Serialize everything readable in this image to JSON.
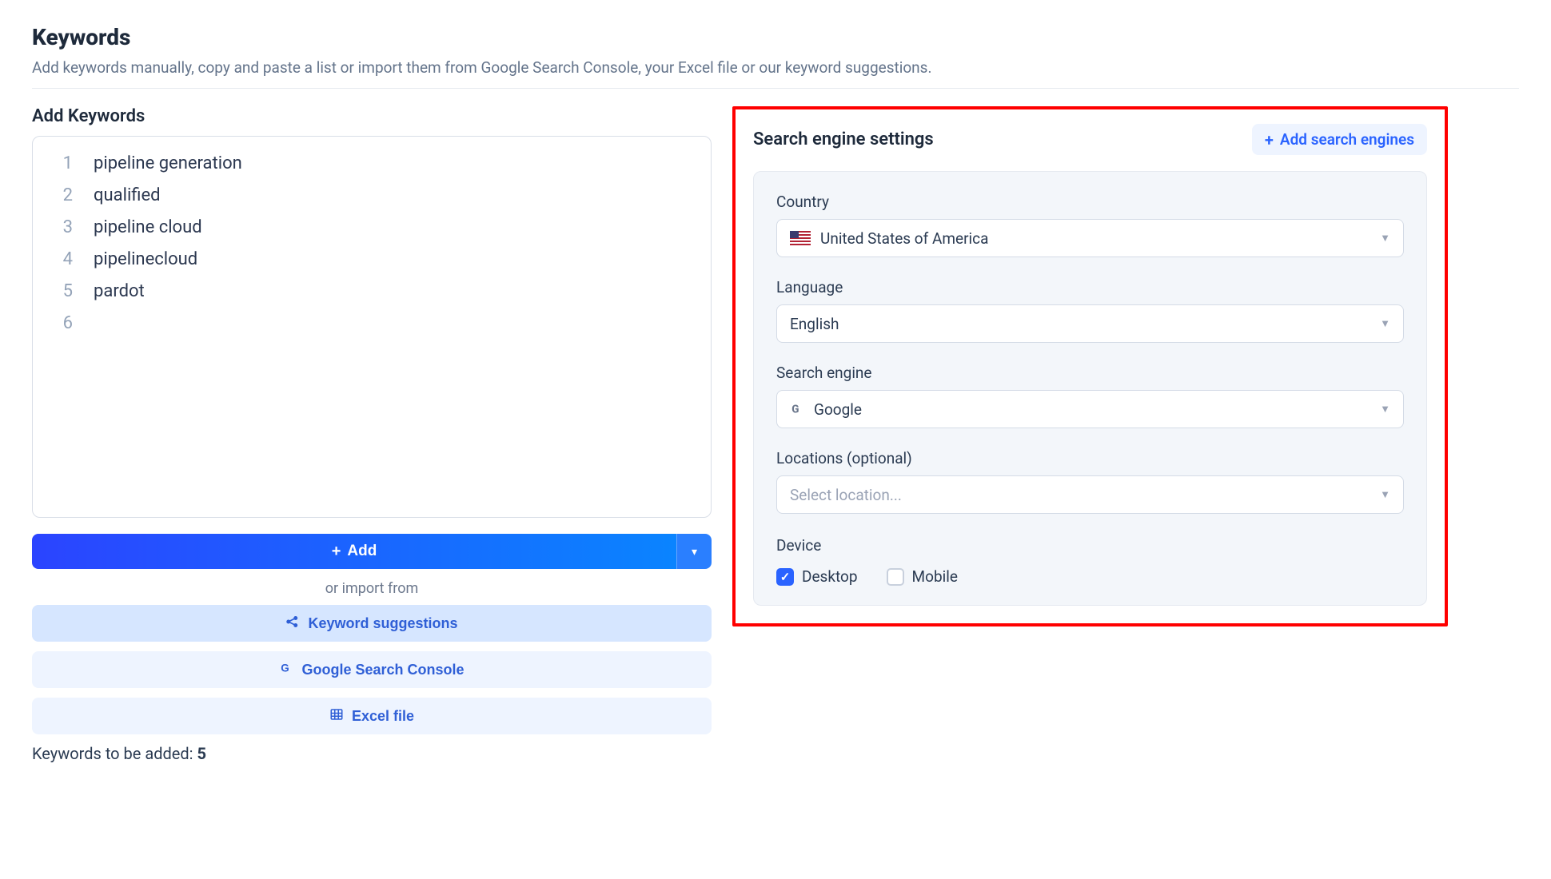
{
  "header": {
    "title": "Keywords",
    "subtitle": "Add keywords manually, copy and paste a list or import them from Google Search Console, your Excel file or our keyword suggestions."
  },
  "left": {
    "section_title": "Add Keywords",
    "keywords": [
      "pipeline generation",
      "qualified",
      "pipeline cloud",
      "pipelinecloud",
      "pardot",
      ""
    ],
    "add_button": "Add",
    "import_label": "or import from",
    "import_suggestions": "Keyword suggestions",
    "import_gsc": "Google Search Console",
    "import_excel": "Excel file",
    "count_label": "Keywords to be added:",
    "count_value": "5"
  },
  "right": {
    "section_title": "Search engine settings",
    "add_engines": "Add search engines",
    "fields": {
      "country_label": "Country",
      "country_value": "United States of America",
      "language_label": "Language",
      "language_value": "English",
      "engine_label": "Search engine",
      "engine_value": "Google",
      "locations_label": "Locations (optional)",
      "locations_placeholder": "Select location...",
      "device_label": "Device",
      "device_desktop": "Desktop",
      "device_mobile": "Mobile"
    }
  }
}
